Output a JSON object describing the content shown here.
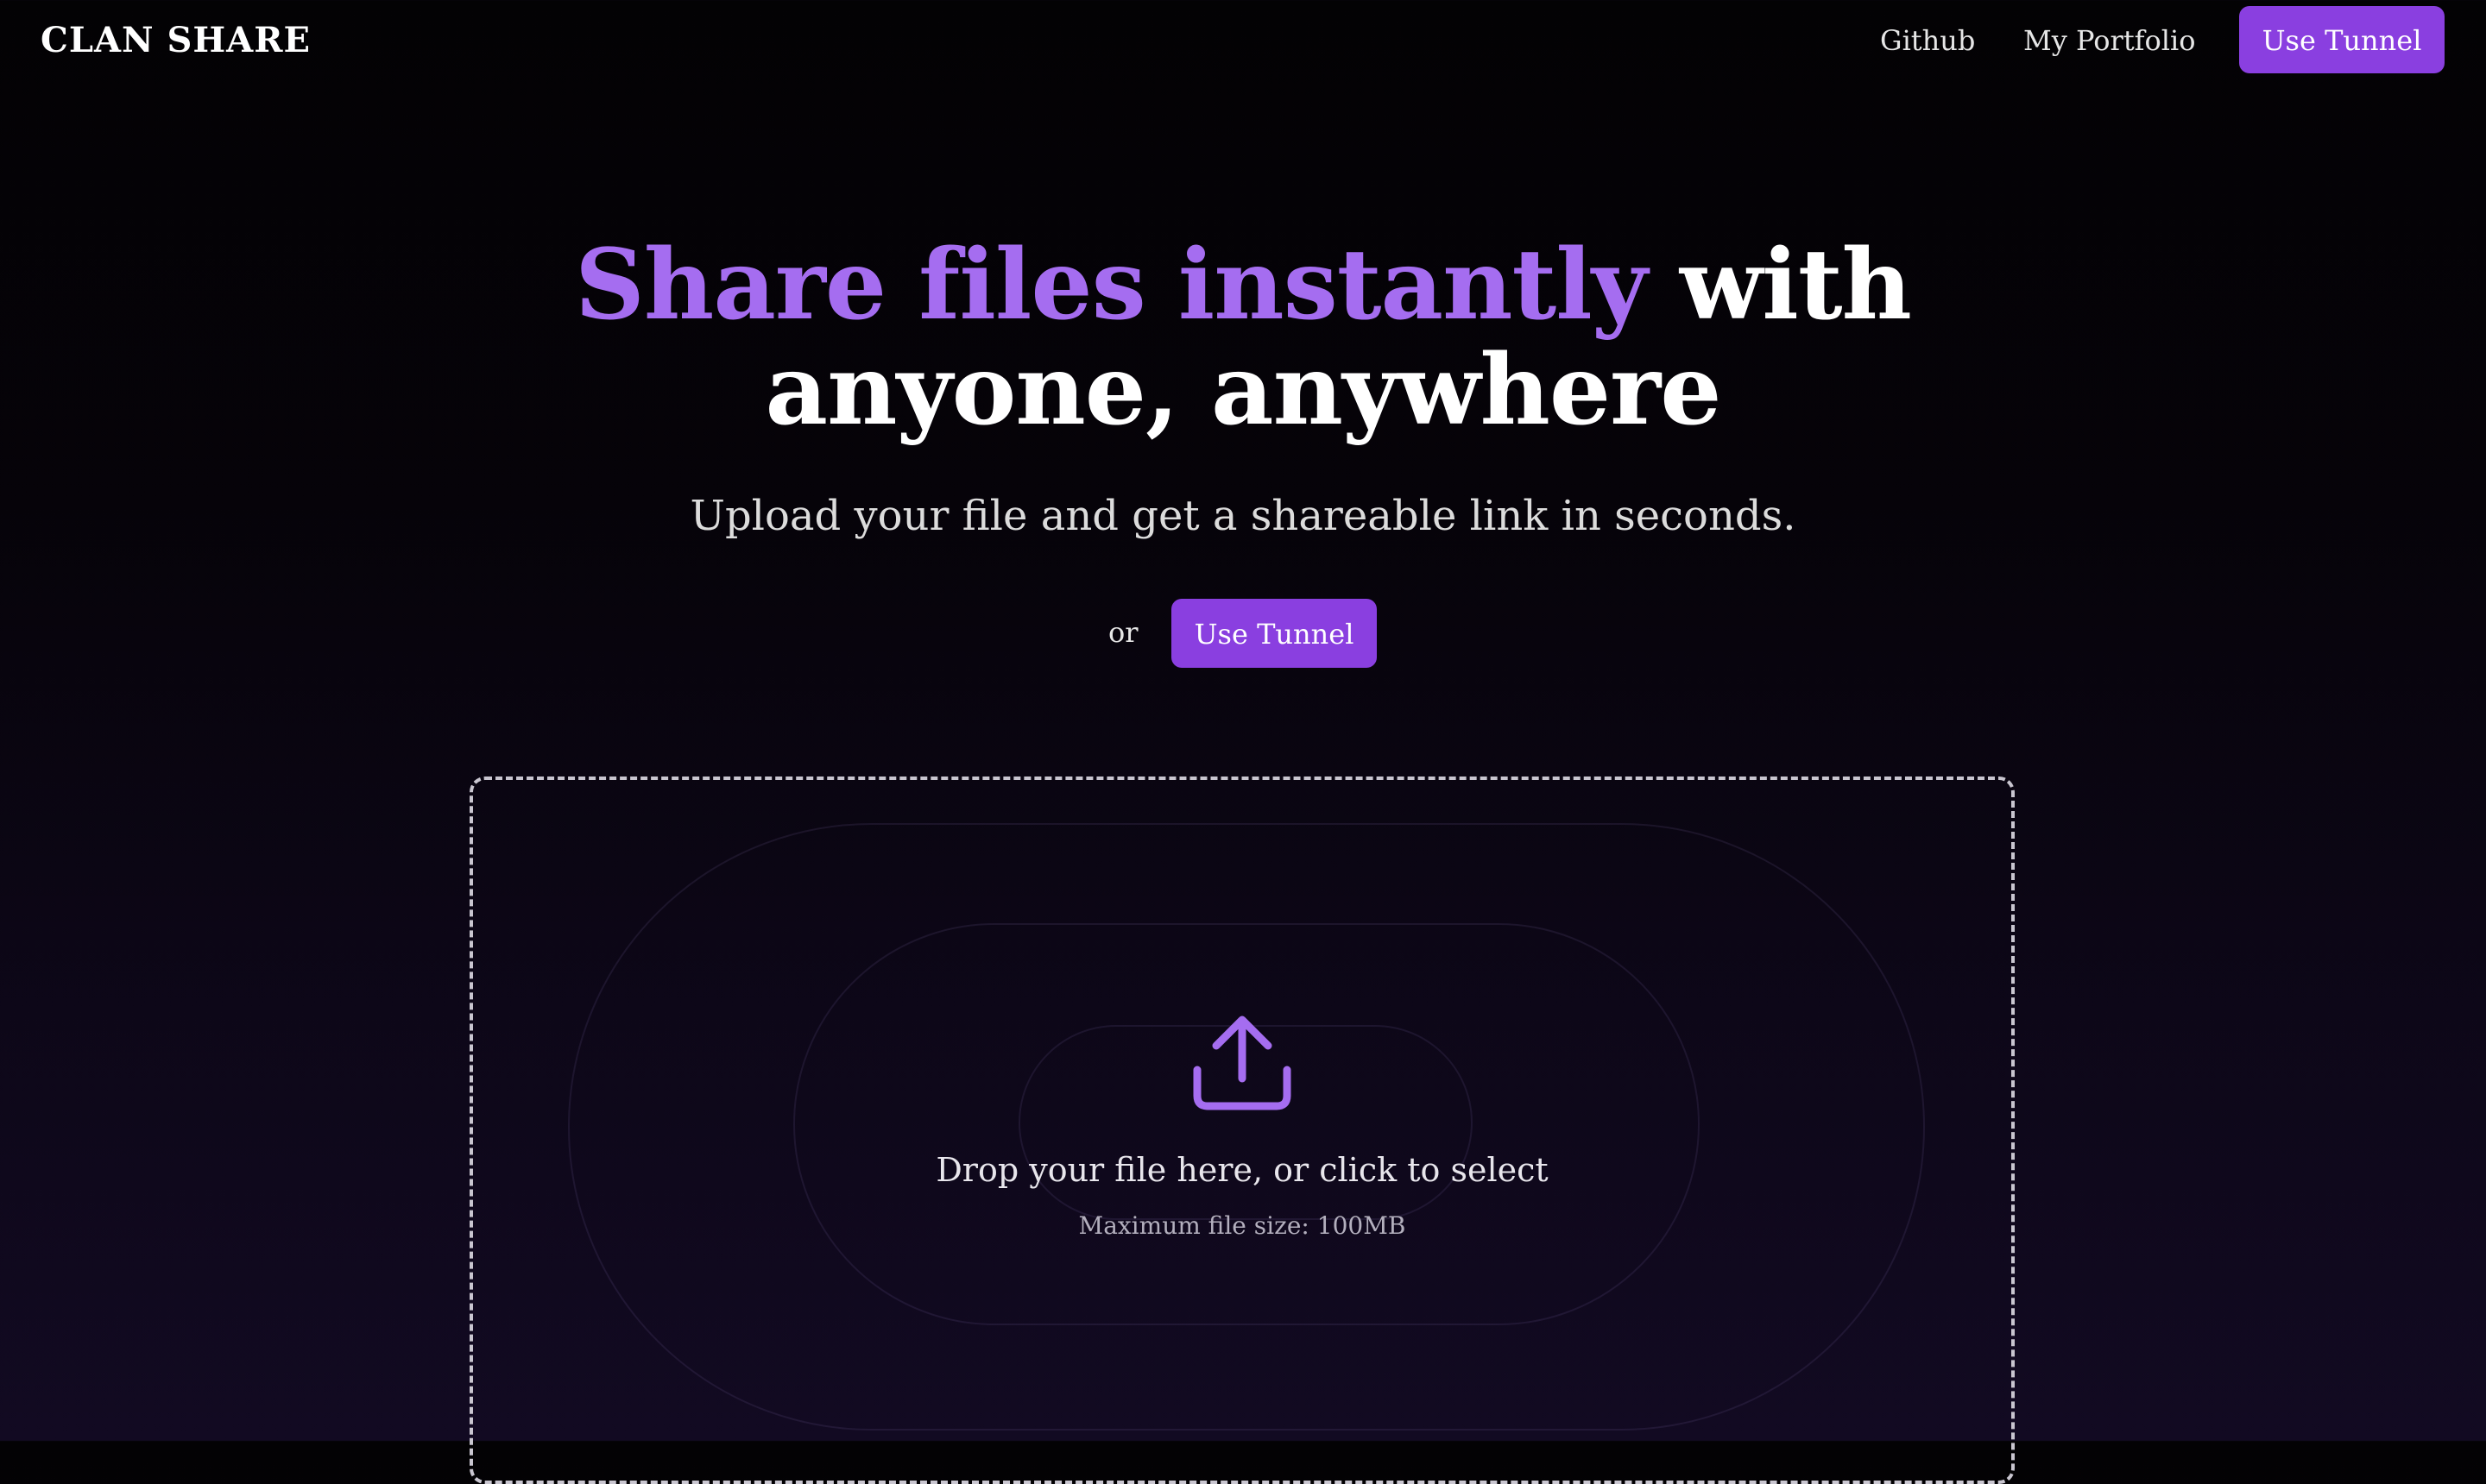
{
  "header": {
    "brand": "CLAN SHARE",
    "nav": {
      "github_label": "Github",
      "portfolio_label": "My Portfolio",
      "tunnel_label": "Use Tunnel"
    }
  },
  "hero": {
    "title_accent": "Share files instantly",
    "title_plain_1": "with",
    "title_plain_2": "anyone, anywhere",
    "subtitle": "Upload your file and get a shareable link in seconds.",
    "or_label": "or",
    "tunnel_label": "Use Tunnel"
  },
  "dropzone": {
    "icon": "upload-icon",
    "title": "Drop your file here, or click to select",
    "hint": "Maximum file size: 100MB"
  },
  "colors": {
    "accent": "#a56df0",
    "button": "#8a3fe0",
    "background": "#030204",
    "background_bottom": "#120a22",
    "text": "#ffffff",
    "muted_text": "#b3afbd"
  }
}
